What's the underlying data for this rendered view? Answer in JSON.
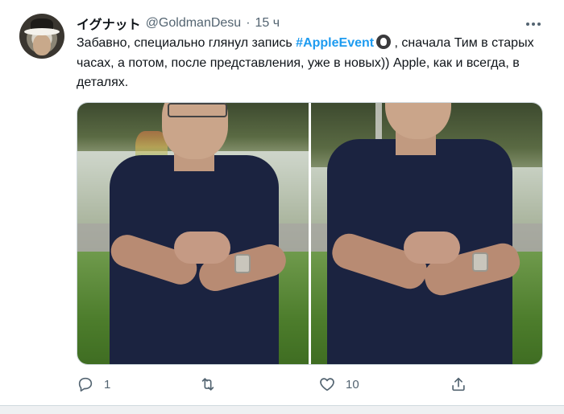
{
  "tweet": {
    "author_name": "イグナット",
    "author_handle": "@GoldmanDesu",
    "separator": "·",
    "time": "15 ч",
    "text_before": "Забавно, специально глянул запись ",
    "hashtag": "#AppleEvent",
    "text_after": " , сначала Тим в старых часах, а потом, после представления, уже в новых)) Apple, как и всегда, в деталях."
  },
  "actions": {
    "reply_count": "1",
    "retweet_count": "",
    "like_count": "10"
  },
  "icons": {
    "more": "more-horizontal-icon",
    "reply": "reply-icon",
    "retweet": "retweet-icon",
    "like": "heart-icon",
    "share": "share-icon"
  },
  "colors": {
    "hashtag": "#1d9bf0",
    "secondary_text": "#536471"
  }
}
